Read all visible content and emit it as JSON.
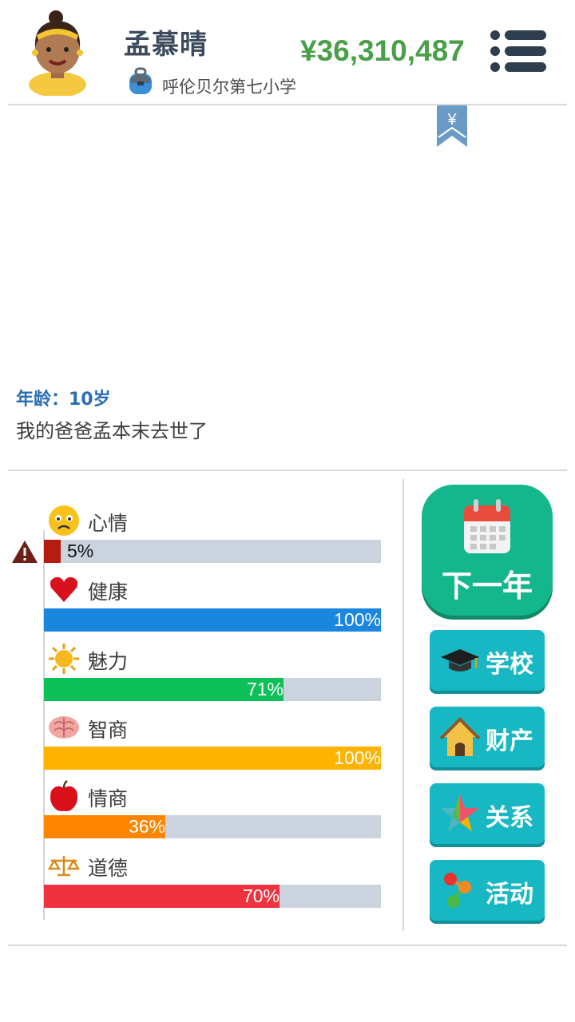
{
  "header": {
    "name": "孟慕晴",
    "school": "呼伦贝尔第七小学",
    "money": "¥36,310,487"
  },
  "bookmark_symbol": "¥",
  "event": {
    "age": "年龄：10岁",
    "text": "我的爸爸孟本末去世了"
  },
  "stats": [
    {
      "label": "心情",
      "icon": "sad-face-icon",
      "value": 5,
      "pct": "5%",
      "color": "#b51e0e"
    },
    {
      "label": "健康",
      "icon": "heart-icon",
      "value": 100,
      "pct": "100%",
      "color": "#1a86de"
    },
    {
      "label": "魅力",
      "icon": "sun-icon",
      "value": 71,
      "pct": "71%",
      "color": "#0ec05a"
    },
    {
      "label": "智商",
      "icon": "brain-icon",
      "value": 100,
      "pct": "100%",
      "color": "#fdb300"
    },
    {
      "label": "情商",
      "icon": "apple-icon",
      "value": 36,
      "pct": "36%",
      "color": "#fd8500"
    },
    {
      "label": "道德",
      "icon": "scales-icon",
      "value": 70,
      "pct": "70%",
      "color": "#ef3240"
    }
  ],
  "buttons": {
    "next_year": "下一年",
    "school": "学校",
    "property": "财产",
    "relations": "关系",
    "activities": "活动"
  },
  "colors": {
    "money": "#49a048",
    "next_year_bg": "#14b68c",
    "side_button_bg": "#17b8c3",
    "age_text": "#2a6db5"
  }
}
